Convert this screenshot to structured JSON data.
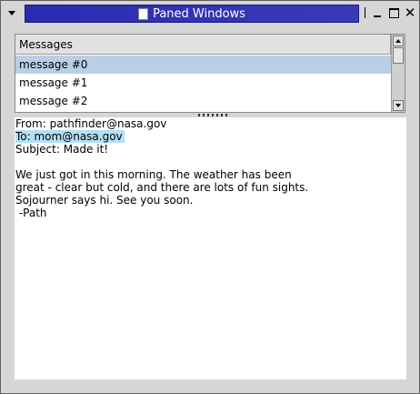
{
  "window": {
    "title": "Paned Windows",
    "close_glyph": "✕"
  },
  "list": {
    "header": "Messages",
    "items": [
      "message #0",
      "message #1",
      "message #2"
    ],
    "selected_index": 0
  },
  "message": {
    "from": "From: pathfinder@nasa.gov",
    "to": "To: mom@nasa.gov",
    "subject": "Subject: Made it!",
    "body": [
      "We just got in this morning. The weather has been",
      "great - clear but cold, and there are lots of fun sights.",
      "Sojourner says hi. See you soon.",
      " -Path"
    ]
  },
  "colors": {
    "title_bg": "#2b2bb0",
    "selection": "#b9cfe6",
    "text_highlight": "#b3dff6"
  },
  "icons": [
    "window-menu-icon",
    "document-icon",
    "minimize-icon",
    "maximize-icon",
    "close-icon",
    "scroll-up-icon",
    "scroll-down-icon"
  ]
}
